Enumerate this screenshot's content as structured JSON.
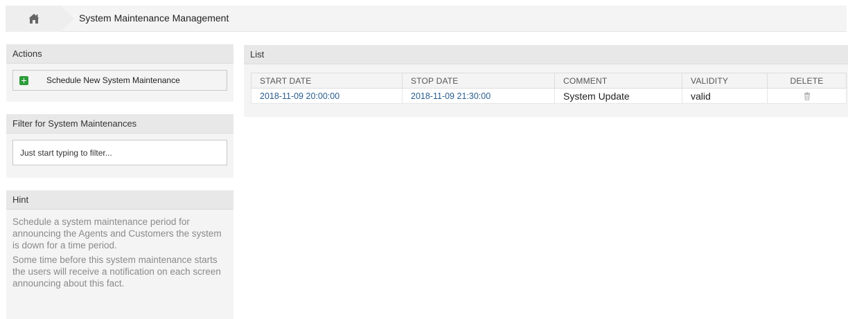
{
  "breadcrumb": {
    "home_icon": "home-icon",
    "current": "System Maintenance Management"
  },
  "sidebar": {
    "actions": {
      "title": "Actions",
      "schedule_button": "Schedule New System Maintenance",
      "schedule_icon": "plus-square-icon"
    },
    "filter": {
      "title": "Filter for System Maintenances",
      "placeholder": "Just start typing to filter..."
    },
    "hint": {
      "title": "Hint",
      "paragraphs": [
        "Schedule a system maintenance period for announcing the Agents and Customers the system is down for a time period.",
        "Some time before this system maintenance starts the users will receive a notification on each screen announcing about this fact."
      ]
    }
  },
  "list": {
    "title": "List",
    "columns": [
      "START DATE",
      "STOP DATE",
      "COMMENT",
      "VALIDITY",
      "DELETE"
    ],
    "rows": [
      {
        "start_date": "2018-11-09 20:00:00",
        "stop_date": "2018-11-09 21:30:00",
        "comment": "System Update",
        "validity": "valid",
        "delete_icon": "trash-icon"
      }
    ]
  },
  "colors": {
    "link": "#2a5d8f",
    "accent_green": "#2d9c3a",
    "panel": "#f4f4f4",
    "header": "#e8e8e8"
  }
}
